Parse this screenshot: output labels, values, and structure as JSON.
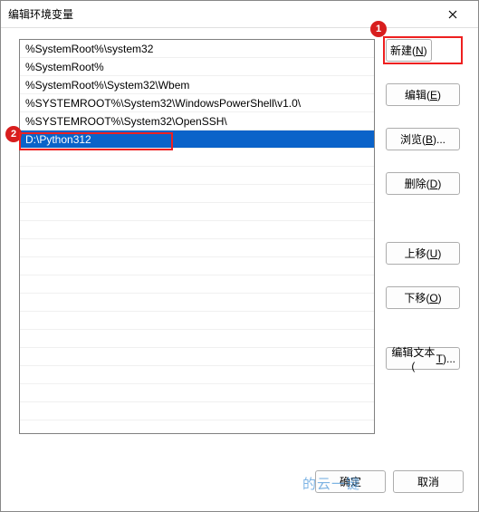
{
  "title": "编辑环境变量",
  "paths": [
    "%SystemRoot%\\system32",
    "%SystemRoot%",
    "%SystemRoot%\\System32\\Wbem",
    "%SYSTEMROOT%\\System32\\WindowsPowerShell\\v1.0\\",
    "%SYSTEMROOT%\\System32\\OpenSSH\\",
    "D:\\Python312"
  ],
  "selected_index": 5,
  "buttons": {
    "new": {
      "label": "新建(",
      "hotkey": "N",
      "suffix": ")"
    },
    "edit": {
      "label": "编辑(",
      "hotkey": "E",
      "suffix": ")"
    },
    "browse": {
      "label": "浏览(",
      "hotkey": "B",
      "suffix": ")..."
    },
    "delete": {
      "label": "删除(",
      "hotkey": "D",
      "suffix": ")"
    },
    "up": {
      "label": "上移(",
      "hotkey": "U",
      "suffix": ")"
    },
    "down": {
      "label": "下移(",
      "hotkey": "O",
      "suffix": ")"
    },
    "edit_text": {
      "label": "编辑文本(",
      "hotkey": "T",
      "suffix": ")..."
    }
  },
  "footer": {
    "ok": "确定",
    "cancel": "取消"
  },
  "annotations": {
    "step1": "1",
    "step2": "2"
  },
  "watermark": "的云一键"
}
